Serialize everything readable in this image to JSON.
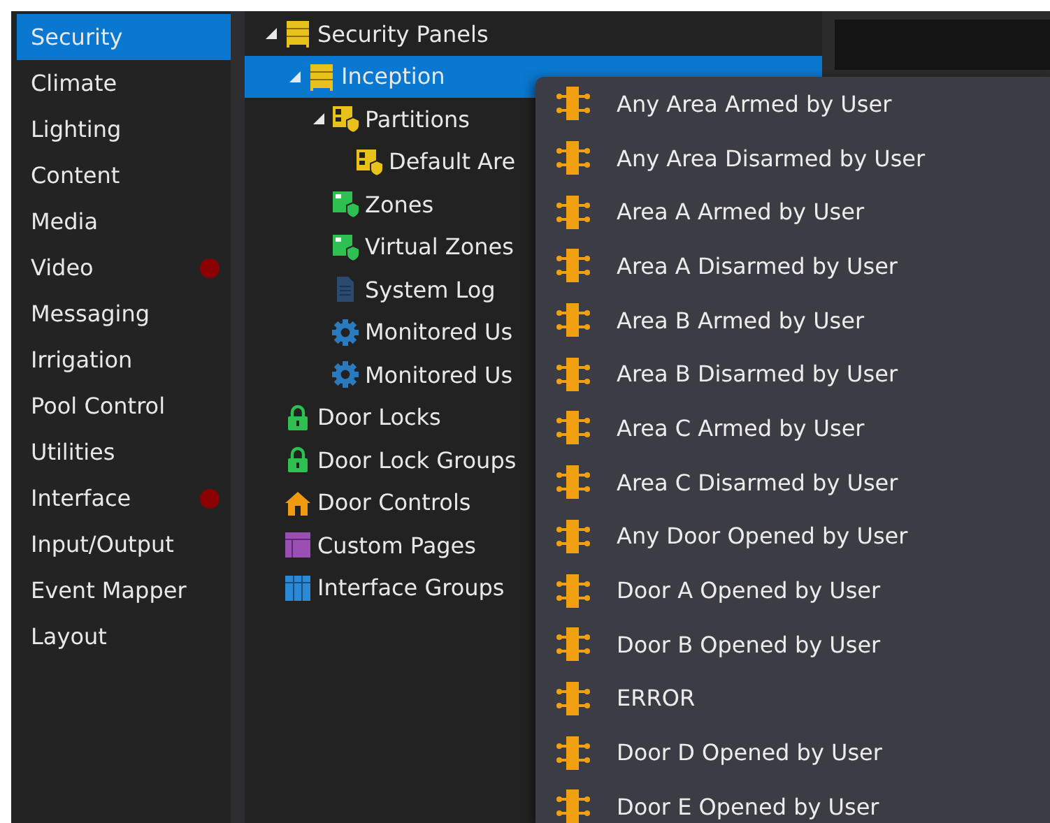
{
  "sidebar": {
    "items": [
      {
        "label": "Security",
        "selected": true,
        "alert": false
      },
      {
        "label": "Climate",
        "selected": false,
        "alert": false
      },
      {
        "label": "Lighting",
        "selected": false,
        "alert": false
      },
      {
        "label": "Content",
        "selected": false,
        "alert": false
      },
      {
        "label": "Media",
        "selected": false,
        "alert": false
      },
      {
        "label": "Video",
        "selected": false,
        "alert": true
      },
      {
        "label": "Messaging",
        "selected": false,
        "alert": false
      },
      {
        "label": "Irrigation",
        "selected": false,
        "alert": false
      },
      {
        "label": "Pool Control",
        "selected": false,
        "alert": false
      },
      {
        "label": "Utilities",
        "selected": false,
        "alert": false
      },
      {
        "label": "Interface",
        "selected": false,
        "alert": true
      },
      {
        "label": "Input/Output",
        "selected": false,
        "alert": false
      },
      {
        "label": "Event Mapper",
        "selected": false,
        "alert": false
      },
      {
        "label": "Layout",
        "selected": false,
        "alert": false
      }
    ]
  },
  "tree": {
    "items": [
      {
        "label": "Security Panels",
        "kind": "panel",
        "selected": false,
        "expanded": true,
        "children": [
          {
            "label": "Inception",
            "kind": "panel",
            "selected": true,
            "expanded": true,
            "children": [
              {
                "label": "Partitions",
                "kind": "partition",
                "selected": false,
                "expanded": true,
                "children": [
                  {
                    "label": "Default Are",
                    "kind": "partition",
                    "selected": false
                  }
                ]
              },
              {
                "label": "Zones",
                "kind": "zone",
                "selected": false
              },
              {
                "label": "Virtual Zones",
                "kind": "zone",
                "selected": false
              },
              {
                "label": "System Log",
                "kind": "log",
                "selected": false
              },
              {
                "label": "Monitored Us",
                "kind": "gear",
                "selected": false
              },
              {
                "label": "Monitored Us",
                "kind": "gear",
                "selected": false
              }
            ]
          }
        ]
      },
      {
        "label": "Door Locks",
        "kind": "lock",
        "selected": false
      },
      {
        "label": "Door Lock Groups",
        "kind": "lock",
        "selected": false
      },
      {
        "label": "Door Controls",
        "kind": "house",
        "selected": false
      },
      {
        "label": "Custom Pages",
        "kind": "page",
        "selected": false
      },
      {
        "label": "Interface Groups",
        "kind": "grid",
        "selected": false
      }
    ]
  },
  "menu": {
    "items": [
      "Any Area Armed by User",
      "Any Area Disarmed by User",
      "Area A Armed by User",
      "Area A Disarmed by User",
      "Area B Armed by User",
      "Area B Disarmed by User",
      "Area C Armed by User",
      "Area C Disarmed by User",
      "Any Door Opened by User",
      "Door A Opened by User",
      "Door B Opened by User",
      "ERROR",
      "Door D Opened by User",
      "Door E Opened by User"
    ]
  }
}
